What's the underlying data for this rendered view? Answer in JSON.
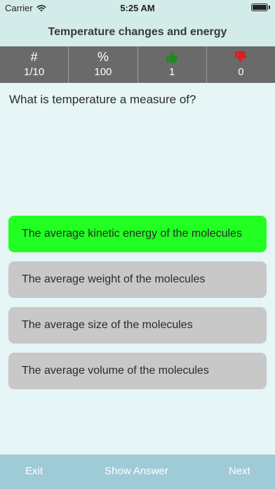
{
  "status_bar": {
    "carrier": "Carrier",
    "time": "5:25 AM",
    "icons": [
      "wifi-icon",
      "battery-icon"
    ]
  },
  "header": {
    "title": "Temperature changes and energy"
  },
  "stats": [
    {
      "head": "#",
      "value": "1/10",
      "icon": null
    },
    {
      "head": "%",
      "value": "100",
      "icon": null
    },
    {
      "head": "",
      "value": "1",
      "icon": "thumbs-up-icon",
      "color": "#1d8a1d"
    },
    {
      "head": "",
      "value": "0",
      "icon": "thumbs-down-icon",
      "color": "#d81f1f"
    }
  ],
  "question": {
    "text": "What is temperature a measure of?"
  },
  "answers": [
    {
      "text": "The average kinetic energy of the molecules",
      "state": "correct"
    },
    {
      "text": "The average weight of the molecules",
      "state": "default"
    },
    {
      "text": "The average size of the molecules",
      "state": "default"
    },
    {
      "text": "The average volume of the molecules",
      "state": "default"
    }
  ],
  "toolbar": {
    "exit_label": "Exit",
    "show_answer_label": "Show Answer",
    "next_label": "Next"
  },
  "colors": {
    "header_bg": "#d3ecea",
    "page_bg": "#e6f5f5",
    "stats_bg": "#6a6a6a",
    "correct_answer": "#22ff22",
    "answer_default": "#c8c8c8",
    "bottom_bar": "#9fcbd7"
  }
}
